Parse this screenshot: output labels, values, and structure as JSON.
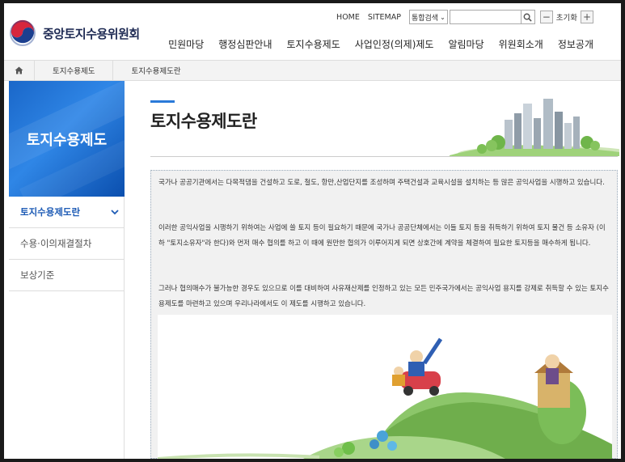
{
  "header": {
    "logo_text": "중앙토지수용위원회",
    "util": {
      "home": "HOME",
      "sitemap": "SITEMAP",
      "search_select": "통합검색",
      "search_value": "",
      "zoom_out": "−",
      "reset": "초기화",
      "zoom_in": "+"
    },
    "gnb": [
      "민원마당",
      "행정심판안내",
      "토지수용제도",
      "사업인정(의제)제도",
      "알림마당",
      "위원회소개",
      "정보공개"
    ]
  },
  "breadcrumb": [
    "토지수용제도",
    "토지수용제도란"
  ],
  "sidebar": {
    "title": "토지수용제도",
    "items": [
      {
        "label": "토지수용제도란",
        "active": true
      },
      {
        "label": "수용·이의재결절차",
        "active": false
      },
      {
        "label": "보상기준",
        "active": false
      }
    ]
  },
  "content": {
    "title": "토지수용제도란",
    "paragraphs": [
      "국가나 공공기관에서는 다목적댐을 건설하고 도로, 철도, 항만,산업단지를 조성하며 주택건설과 교육시설을 설치하는 등 많은 공익사업을 시행하고 있습니다.",
      "이러한 공익사업을 시행하기 위하여는 사업에 쓸 토지 등이 필요하기 때문에 국가나 공공단체에서는 이들 토지 등을 취득하기 위하여 토지 물건 등 소유자 (이하 \"토지소유자\"라 한다)와 먼저 매수 협의를 하고 이 때에 원만한 협의가 이루어지게 되면 상호간에 계약을 체결하여 필요한 토지등을 매수하게 됩니다.",
      "그러나 협의매수가 불가능한 경우도 있으므로 이를 대비하여 사유재산제를 인정하고 있는 모든 민주국가에서는 공익사업 용지를 강제로 취득할 수 있는 토지수용제도를 마련하고 있으며 우리나라에서도 이 제도를 시행하고 있습니다."
    ]
  },
  "colors": {
    "accent": "#2a7ad9",
    "sidebar_blue": "#1a67c9",
    "active_text": "#1d5bb5"
  }
}
